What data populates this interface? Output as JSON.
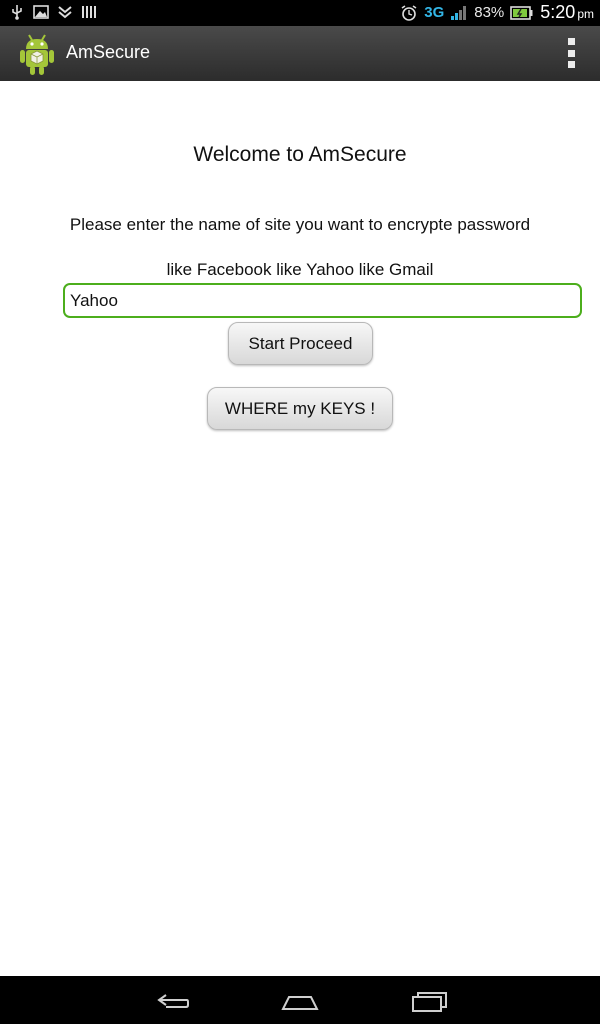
{
  "status_bar": {
    "battery_percent": "83%",
    "network": "3G",
    "time": "5:20",
    "ampm": "pm",
    "icons": [
      "usb-icon",
      "image-icon",
      "download-icon",
      "signal-bars-icon",
      "alarm-icon",
      "battery-icon"
    ]
  },
  "action_bar": {
    "title": "AmSecure",
    "icon": "android-app-icon",
    "menu_icon": "overflow-menu-icon"
  },
  "main": {
    "welcome": "Welcome to AmSecure",
    "instruction": "Please enter the name of site you want to encrypte password",
    "hint": "like Facebook like Yahoo like Gmail",
    "site_input": {
      "value": "Yahoo",
      "placeholder": ""
    },
    "proceed_label": "Start Proceed",
    "keys_label": "WHERE my KEYS !"
  },
  "nav_bar": {
    "icons": [
      "back-icon",
      "home-icon",
      "recent-apps-icon"
    ]
  },
  "colors": {
    "input_border": "#4cae1c",
    "action_bar_bg": "#3a3a3a",
    "status_accent": "#33b5e5"
  }
}
